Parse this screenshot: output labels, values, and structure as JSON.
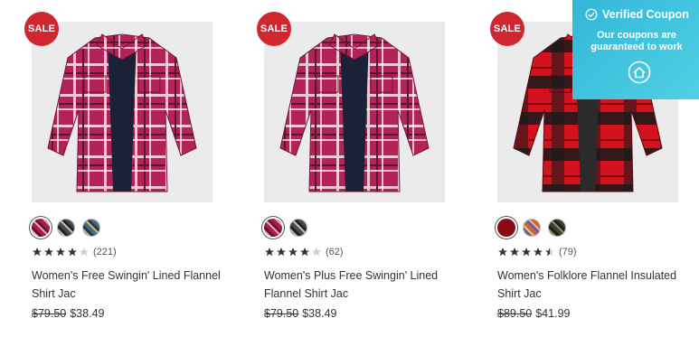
{
  "products": [
    {
      "badge": "SALE",
      "image_alt": "Magenta plaid flannel shirt jacket",
      "colors": [
        "#a51e4c",
        "#4a4a4a",
        "#3f6e8a"
      ],
      "selected_color_index": 0,
      "rating": 4,
      "review_count": "(221)",
      "title": "Women's Free Swingin' Lined Flannel Shirt Jac",
      "original_price": "$79.50",
      "sale_price": "$38.49"
    },
    {
      "badge": "SALE",
      "image_alt": "Magenta plaid flannel shirt jacket",
      "colors": [
        "#a51e4c",
        "#4a4a4a"
      ],
      "selected_color_index": 0,
      "rating": 4,
      "review_count": "(62)",
      "title": "Women's Plus Free Swingin' Lined Flannel Shirt Jac",
      "original_price": "$79.50",
      "sale_price": "$38.49"
    },
    {
      "badge": "SALE",
      "image_alt": "Red and black plaid insulated flannel shirt jacket",
      "colors": [
        "#8b0a14",
        "#c86a2e",
        "#3b3f2f"
      ],
      "selected_color_index": 0,
      "rating": 4.5,
      "review_count": "(79)",
      "title": "Women's Folklore Flannel Insulated Shirt Jac",
      "original_price": "$89.50",
      "sale_price": "$41.99"
    }
  ],
  "coupon_overlay": {
    "title": "Verified Coupon",
    "subtitle": "Our coupons are guaranteed to work",
    "icon": "home-icon",
    "bg_color": "#3cc2de"
  }
}
